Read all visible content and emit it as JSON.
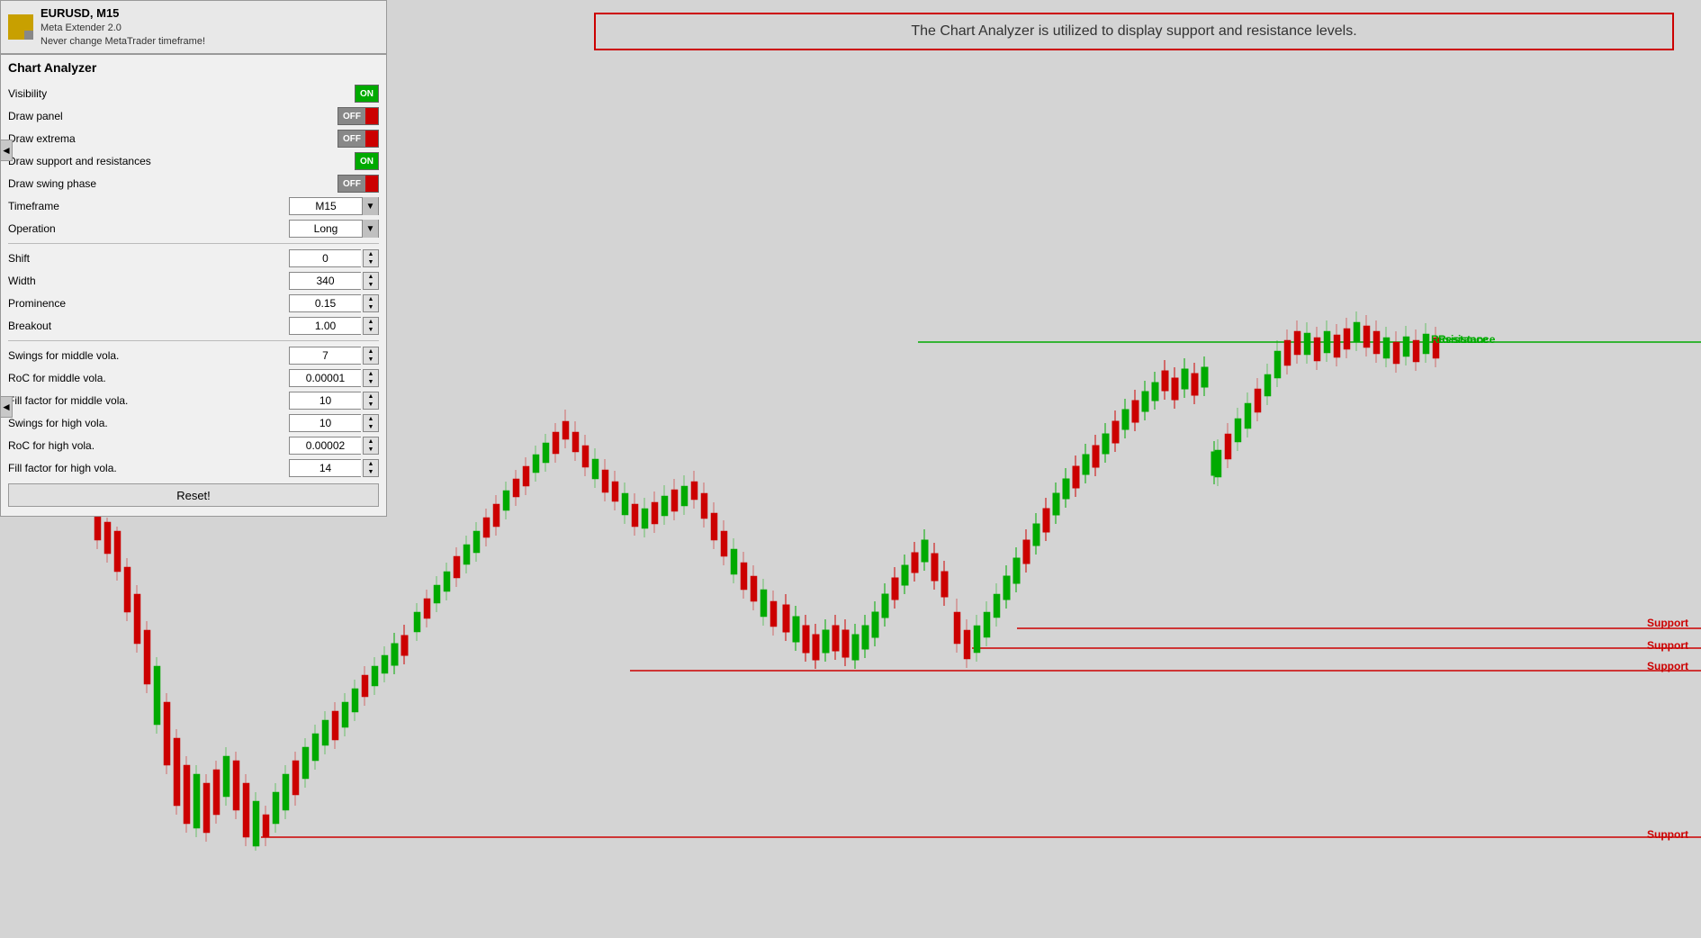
{
  "header": {
    "symbol": "EURUSD, M15",
    "meta": "Meta Extender 2.0",
    "warning": "Never change MetaTrader timeframe!"
  },
  "panel": {
    "title": "Chart Analyzer",
    "params": {
      "visibility_label": "Visibility",
      "visibility_state": "ON",
      "draw_panel_label": "Draw panel",
      "draw_panel_state": "OFF",
      "draw_extrema_label": "Draw extrema",
      "draw_extrema_state": "OFF",
      "draw_support_label": "Draw support and resistances",
      "draw_support_state": "ON",
      "draw_swing_label": "Draw swing phase",
      "draw_swing_state": "OFF",
      "timeframe_label": "Timeframe",
      "timeframe_value": "M15",
      "operation_label": "Operation",
      "operation_value": "Long",
      "shift_label": "Shift",
      "shift_value": "0",
      "width_label": "Width",
      "width_value": "340",
      "prominence_label": "Prominence",
      "prominence_value": "0.15",
      "breakout_label": "Breakout",
      "breakout_value": "1.00",
      "swings_mid_label": "Swings for middle vola.",
      "swings_mid_value": "7",
      "roc_mid_label": "RoC for middle vola.",
      "roc_mid_value": "0.00001",
      "fill_mid_label": "Fill factor for middle vola.",
      "fill_mid_value": "10",
      "swings_high_label": "Swings for high vola.",
      "swings_high_value": "10",
      "roc_high_label": "RoC for high vola.",
      "roc_high_value": "0.00002",
      "fill_high_label": "Fill factor for high vola.",
      "fill_high_value": "14"
    },
    "reset_label": "Reset!"
  },
  "info_box": {
    "text": "The Chart Analyzer is utilized to display support and resistance levels."
  },
  "chart": {
    "resistance_label": "Resistance",
    "support_labels": [
      "Support",
      "Support",
      "Support",
      "Support"
    ]
  },
  "collapse_arrows": [
    "◄",
    "◄"
  ]
}
